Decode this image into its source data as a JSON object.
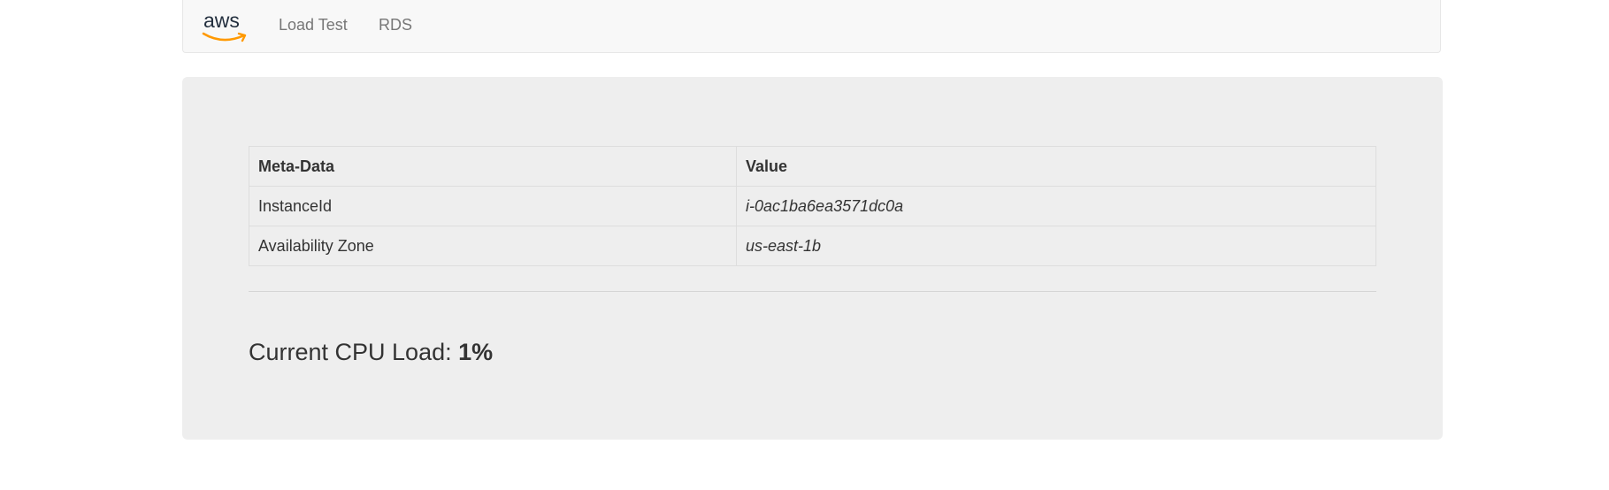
{
  "navbar": {
    "brand_icon": "aws-logo-icon",
    "brand_text": "aws",
    "links": [
      {
        "label": "Load Test"
      },
      {
        "label": "RDS"
      }
    ]
  },
  "metadata_table": {
    "headers": [
      "Meta-Data",
      "Value"
    ],
    "rows": [
      {
        "key": "InstanceId",
        "value": "i-0ac1ba6ea3571dc0a"
      },
      {
        "key": "Availability Zone",
        "value": "us-east-1b"
      }
    ]
  },
  "cpu": {
    "label": "Current CPU Load: ",
    "value": "1%"
  },
  "colors": {
    "aws_text": "#232f3e",
    "aws_smile": "#ff9900",
    "panel_bg": "#eeeeee",
    "navbar_bg": "#f8f8f8"
  }
}
